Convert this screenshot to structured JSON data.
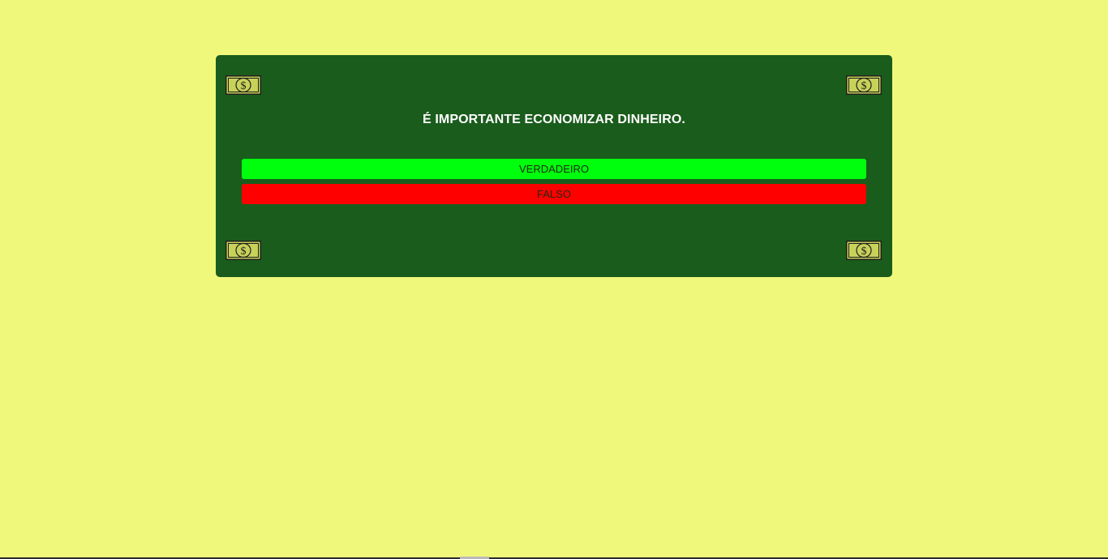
{
  "question": {
    "text": "É IMPORTANTE ECONOMIZAR DINHEIRO."
  },
  "answers": [
    {
      "label": "VERDADEIRO",
      "color": "#00ff0c"
    },
    {
      "label": "FALSO",
      "color": "#ff0000"
    }
  ],
  "colors": {
    "page_background": "#f0f87c",
    "card_background": "#1a5c1c",
    "question_text": "#ffffff"
  },
  "icons": {
    "decoration": "dollar-bill-icon"
  }
}
